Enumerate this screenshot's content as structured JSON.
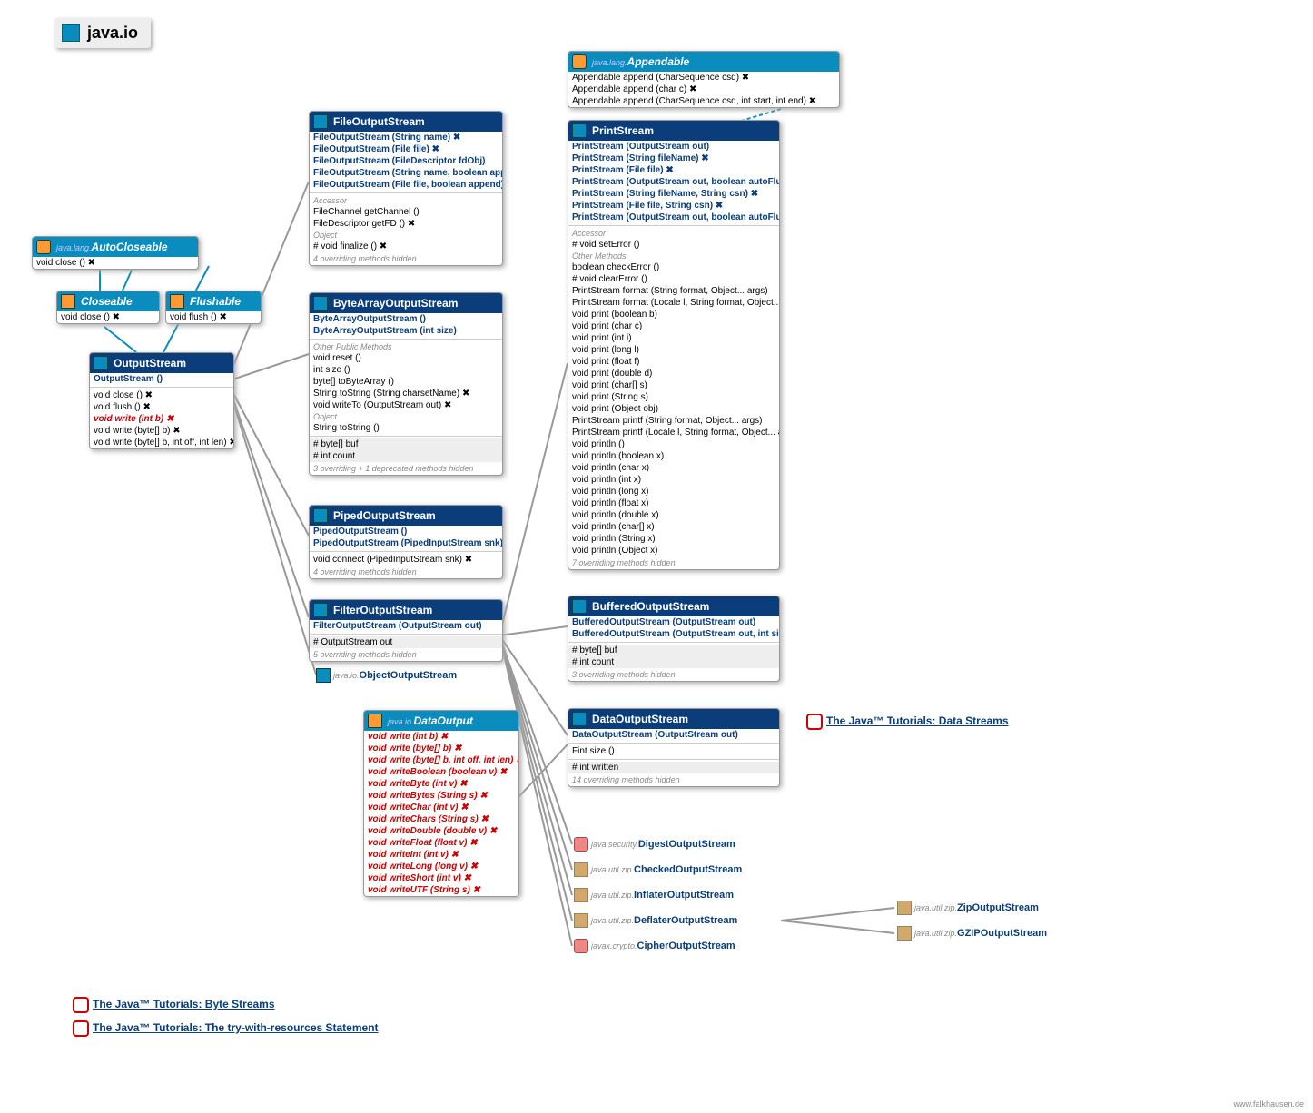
{
  "title": "java.io",
  "credit": "www.falkhausen.de",
  "links": {
    "l1": "The Java™ Tutorials: Byte Streams",
    "l2": "The Java™ Tutorials: The try-with-resources Statement",
    "l3": "The Java™ Tutorials: Data Streams"
  },
  "autoCloseable": {
    "hdr": "AutoCloseable",
    "pkg": "java.lang.",
    "m1": "void  close () ✖"
  },
  "closeable": {
    "hdr": "Closeable",
    "m1": "void  close () ✖"
  },
  "flushable": {
    "hdr": "Flushable",
    "m1": "void  flush () ✖"
  },
  "outputStream": {
    "hdr": "OutputStream",
    "c1": "OutputStream ()",
    "m1": "void  close () ✖",
    "m2": "void  flush () ✖",
    "m3": "void  write (int b) ✖",
    "m4": "void  write (byte[] b) ✖",
    "m5": "void  write (byte[] b, int off, int len) ✖"
  },
  "fileOS": {
    "hdr": "FileOutputStream",
    "c1": "FileOutputStream (String name) ✖",
    "c2": "FileOutputStream (File file) ✖",
    "c3": "FileOutputStream (FileDescriptor fdObj)",
    "c4": "FileOutputStream (String name, boolean append) ✖",
    "c5": "FileOutputStream (File file, boolean append) ✖",
    "s1": "Accessor",
    "m1": "FileChannel  getChannel ()",
    "m2": "FileDescriptor  getFD () ✖",
    "s2": "Object",
    "m3": "#           void  finalize () ✖",
    "f": "4 overriding methods hidden"
  },
  "baOS": {
    "hdr": "ByteArrayOutputStream",
    "c1": "ByteArrayOutputStream ()",
    "c2": "ByteArrayOutputStream (int size)",
    "s1": "Other Public Methods",
    "m1": "void  reset ()",
    "m2": "int  size ()",
    "m3": "byte[]  toByteArray ()",
    "m4": "String  toString (String charsetName) ✖",
    "m5": "void  writeTo (OutputStream out) ✖",
    "s2": "Object",
    "m6": "String  toString ()",
    "fld1": "# byte[]  buf",
    "fld2": "# int  count",
    "f": "3 overriding + 1 deprecated methods hidden"
  },
  "pipedOS": {
    "hdr": "PipedOutputStream",
    "c1": "PipedOutputStream ()",
    "c2": "PipedOutputStream (PipedInputStream snk) ✖",
    "m1": "void  connect (PipedInputStream snk) ✖",
    "f": "4 overriding methods hidden"
  },
  "filterOS": {
    "hdr": "FilterOutputStream",
    "c1": "FilterOutputStream (OutputStream out)",
    "fld1": "# OutputStream  out",
    "f": "5 overriding methods hidden"
  },
  "oos": {
    "pkg": "java.io.",
    "cls": "ObjectOutputStream"
  },
  "dataOutput": {
    "hdr": "DataOutput",
    "pkg": "java.io.",
    "m1": "void  write (int b) ✖",
    "m2": "void  write (byte[] b) ✖",
    "m3": "void  write (byte[] b, int off, int len) ✖",
    "m4": "void  writeBoolean (boolean v) ✖",
    "m5": "void  writeByte (int v) ✖",
    "m6": "void  writeBytes (String s) ✖",
    "m7": "void  writeChar (int v) ✖",
    "m8": "void  writeChars (String s) ✖",
    "m9": "void  writeDouble (double v) ✖",
    "m10": "void  writeFloat (float v) ✖",
    "m11": "void  writeInt (int v) ✖",
    "m12": "void  writeLong (long v) ✖",
    "m13": "void  writeShort (int v) ✖",
    "m14": "void  writeUTF (String s) ✖"
  },
  "appendable": {
    "hdr": "Appendable",
    "pkg": "java.lang.",
    "m1": "Appendable  append (CharSequence csq) ✖",
    "m2": "Appendable  append (char c) ✖",
    "m3": "Appendable  append (CharSequence csq, int start, int end) ✖"
  },
  "printStream": {
    "hdr": "PrintStream",
    "c1": "PrintStream (OutputStream out)",
    "c2": "PrintStream (String fileName) ✖",
    "c3": "PrintStream (File file) ✖",
    "c4": "PrintStream (OutputStream out, boolean autoFlush)",
    "c5": "PrintStream (String fileName, String csn) ✖",
    "c6": "PrintStream (File file, String csn) ✖",
    "c7": "PrintStream (OutputStream out, boolean autoFlush, String encoding) ✖",
    "s1": "Accessor",
    "m1": "#        void  setError ()",
    "s2": "Other Methods",
    "m2": "boolean  checkError ()",
    "m3": "#        void  clearError ()",
    "m4": "PrintStream  format (String format, Object... args)",
    "m5": "PrintStream  format (Locale l, String format, Object... args)",
    "m6": "void  print (boolean b)",
    "m7": "void  print (char c)",
    "m8": "void  print (int i)",
    "m9": "void  print (long l)",
    "m10": "void  print (float f)",
    "m11": "void  print (double d)",
    "m12": "void  print (char[] s)",
    "m13": "void  print (String s)",
    "m14": "void  print (Object obj)",
    "m15": "PrintStream  printf (String format, Object... args)",
    "m16": "PrintStream  printf (Locale l, String format, Object... args)",
    "m17": "void  println ()",
    "m18": "void  println (boolean x)",
    "m19": "void  println (char x)",
    "m20": "void  println (int x)",
    "m21": "void  println (long x)",
    "m22": "void  println (float x)",
    "m23": "void  println (double x)",
    "m24": "void  println (char[] x)",
    "m25": "void  println (String x)",
    "m26": "void  println (Object x)",
    "f": "7 overriding methods hidden"
  },
  "bufOS": {
    "hdr": "BufferedOutputStream",
    "c1": "BufferedOutputStream (OutputStream out)",
    "c2": "BufferedOutputStream (OutputStream out, int size)",
    "fld1": "# byte[]  buf",
    "fld2": "# int  count",
    "f": "3 overriding methods hidden"
  },
  "dataOS": {
    "hdr": "DataOutputStream",
    "c1": "DataOutputStream (OutputStream out)",
    "m1": "Fint  size ()",
    "fld1": "# int  written",
    "f": "14 overriding methods hidden"
  },
  "ext": {
    "digest": {
      "pkg": "java.security.",
      "cls": "DigestOutputStream"
    },
    "checked": {
      "pkg": "java.util.zip.",
      "cls": "CheckedOutputStream"
    },
    "inflater": {
      "pkg": "java.util.zip.",
      "cls": "InflaterOutputStream"
    },
    "deflater": {
      "pkg": "java.util.zip.",
      "cls": "DeflaterOutputStream"
    },
    "cipher": {
      "pkg": "javax.crypto.",
      "cls": "CipherOutputStream"
    },
    "zip": {
      "pkg": "java.util.zip.",
      "cls": "ZipOutputStream"
    },
    "gzip": {
      "pkg": "java.util.zip.",
      "cls": "GZIPOutputStream"
    }
  }
}
